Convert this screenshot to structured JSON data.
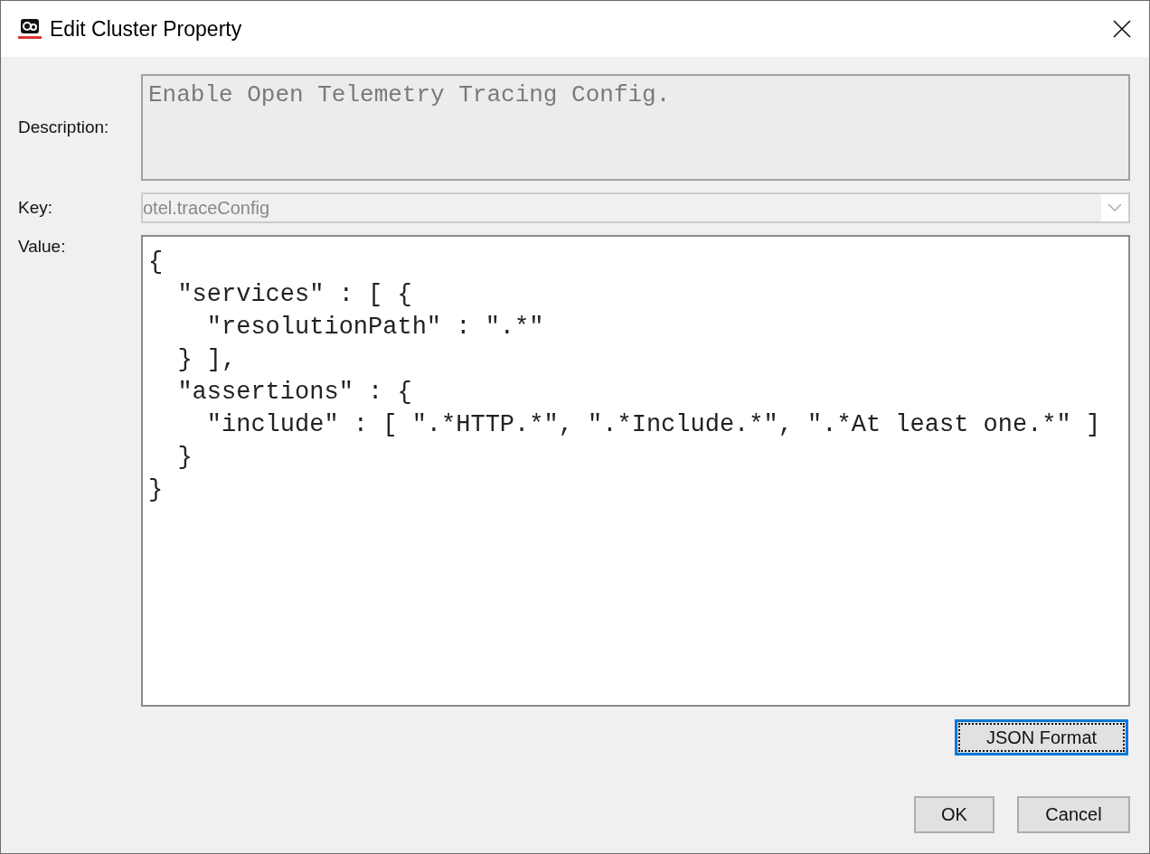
{
  "window": {
    "title": "Edit Cluster Property"
  },
  "description": {
    "label": "Description:",
    "value": "Enable Open Telemetry Tracing Config."
  },
  "key": {
    "label": "Key:",
    "value": "otel.traceConfig",
    "disabled": true
  },
  "value": {
    "label": "Value:",
    "lines": [
      "{",
      "  \"services\" : [ {",
      "    \"resolutionPath\" : \".*\"",
      "  } ],",
      "  \"assertions\" : {",
      "    \"include\" : [ \".*HTTP.*\", \".*Include.*\", \".*At least one.*\" ]",
      "  }",
      "}"
    ]
  },
  "format_button": {
    "label": "JSON Format",
    "focused": true
  },
  "buttons": [
    {
      "label": "OK"
    },
    {
      "label": "Cancel"
    }
  ]
}
